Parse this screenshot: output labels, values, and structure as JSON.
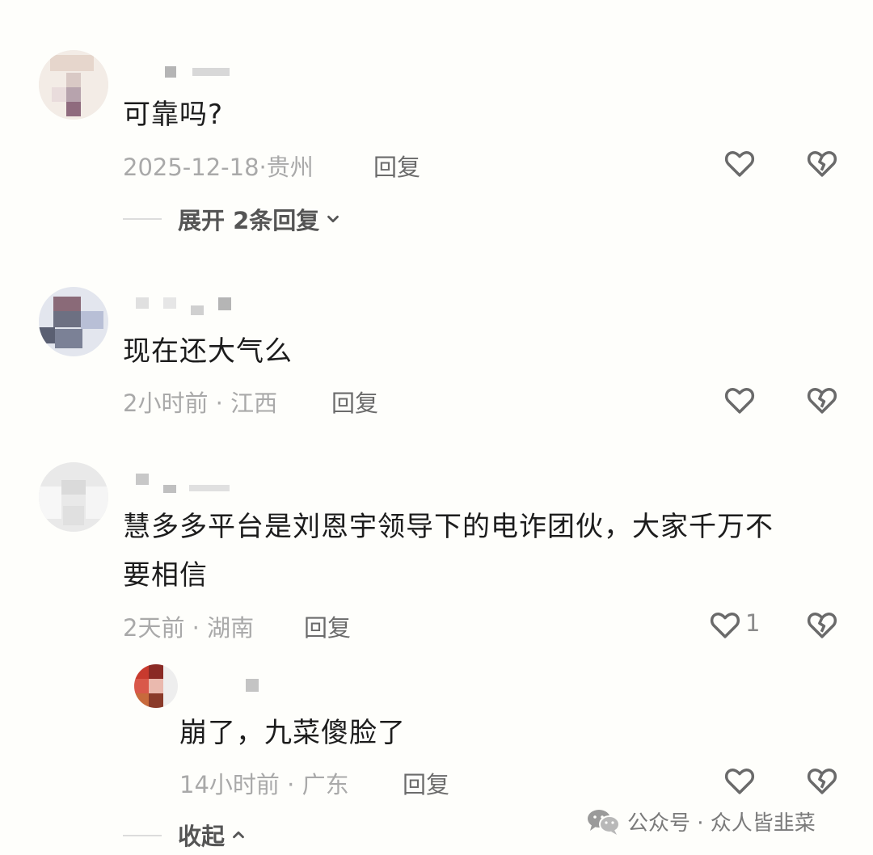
{
  "comments": [
    {
      "text": "可靠吗?",
      "time": "2025-12-18",
      "location": "贵州",
      "reply_label": "回复",
      "likes": "",
      "expand_label": "展开 2条回复"
    },
    {
      "text": "现在还大气么",
      "time": "2小时前",
      "location": "江西",
      "reply_label": "回复",
      "likes": ""
    },
    {
      "text_line1": "慧多多平台是刘恩宇领导下的电诈团伙，大家千万不",
      "text_line2": "要相信",
      "time": "2天前",
      "location": "湖南",
      "reply_label": "回复",
      "likes": "1",
      "reply": {
        "text": "崩了，九菜傻脸了",
        "time": "14小时前",
        "location": "广东",
        "reply_label": "回复",
        "likes": ""
      },
      "collapse_label": "收起"
    }
  ],
  "watermark": {
    "label": "公众号 · 众人皆韭菜",
    "icon": "wechat-icon"
  },
  "colors": {
    "text": "#1c1c1c",
    "meta": "#a9a9a9",
    "reply": "#6b6b6b",
    "icon": "#6a6a6a"
  }
}
